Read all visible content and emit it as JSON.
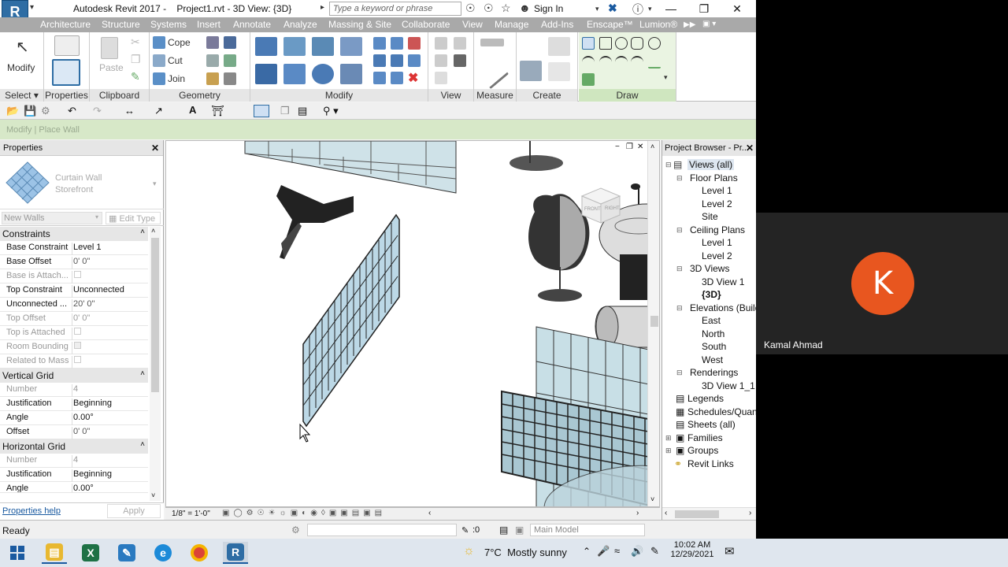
{
  "app": {
    "logo": "R",
    "title": "Autodesk Revit 2017 -",
    "file_title": "Project1.rvt - 3D View: {3D}",
    "search_placeholder": "Type a keyword or phrase",
    "sign_in": "Sign In",
    "window_controls": {
      "minimize": "—",
      "restore": "❐",
      "close": "✕"
    }
  },
  "tabs": [
    "Architecture",
    "Structure",
    "Systems",
    "Insert",
    "Annotate",
    "Analyze",
    "Massing & Site",
    "Collaborate",
    "View",
    "Manage",
    "Add-Ins",
    "Enscape™",
    "Lumion®"
  ],
  "ribbon": {
    "modify_label": "Modify",
    "paste_label": "Paste",
    "cope_label": "Cope",
    "cut_label": "Cut",
    "join_label": "Join",
    "panels": [
      "Select",
      "Properties",
      "Clipboard",
      "Geometry",
      "Modify",
      "View",
      "Measure",
      "Create",
      "Draw"
    ]
  },
  "option_bar": {
    "text": "Modify | Place Wall"
  },
  "properties": {
    "title": "Properties",
    "type_family": "Curtain Wall",
    "type_name": "Storefront",
    "instance_selector": "New Walls",
    "edit_type": "Edit Type",
    "groups": {
      "constraints": "Constraints",
      "vertical_grid": "Vertical Grid",
      "horizontal_grid": "Horizontal Grid"
    },
    "constraints": [
      {
        "k": "Base Constraint",
        "v": "Level 1"
      },
      {
        "k": "Base Offset",
        "v": "0'  0\""
      },
      {
        "k": "Base is Attach...",
        "v": ""
      },
      {
        "k": "Top Constraint",
        "v": "Unconnected"
      },
      {
        "k": "Unconnected ...",
        "v": "20'  0\""
      },
      {
        "k": "Top Offset",
        "v": "0'  0\""
      },
      {
        "k": "Top is Attached",
        "v": ""
      },
      {
        "k": "Room Bounding",
        "v": ""
      },
      {
        "k": "Related to Mass",
        "v": ""
      }
    ],
    "vertical_grid": [
      {
        "k": "Number",
        "v": "4"
      },
      {
        "k": "Justification",
        "v": "Beginning"
      },
      {
        "k": "Angle",
        "v": "0.00°"
      },
      {
        "k": "Offset",
        "v": "0'  0\""
      }
    ],
    "horizontal_grid": [
      {
        "k": "Number",
        "v": "4"
      },
      {
        "k": "Justification",
        "v": "Beginning"
      },
      {
        "k": "Angle",
        "v": "0.00°"
      }
    ],
    "help_link": "Properties help",
    "apply": "Apply"
  },
  "view": {
    "scale": "1/8\" = 1'-0\"",
    "viewcube_front": "FRONT",
    "viewcube_right": "RIGHT"
  },
  "project_browser": {
    "title": "Project Browser - Pr...",
    "items": [
      {
        "label": "Views (all)"
      },
      {
        "label": "Floor Plans"
      },
      {
        "label": "Level 1"
      },
      {
        "label": "Level 2"
      },
      {
        "label": "Site"
      },
      {
        "label": "Ceiling Plans"
      },
      {
        "label": "Level 1"
      },
      {
        "label": "Level 2"
      },
      {
        "label": "3D Views"
      },
      {
        "label": "3D View 1"
      },
      {
        "label": "{3D}"
      },
      {
        "label": "Elevations (Build"
      },
      {
        "label": "East"
      },
      {
        "label": "North"
      },
      {
        "label": "South"
      },
      {
        "label": "West"
      },
      {
        "label": "Renderings"
      },
      {
        "label": "3D View 1_1"
      },
      {
        "label": "Legends"
      },
      {
        "label": "Schedules/Quant"
      },
      {
        "label": "Sheets (all)"
      },
      {
        "label": "Families"
      },
      {
        "label": "Groups"
      },
      {
        "label": "Revit Links"
      }
    ]
  },
  "status": {
    "ready": "Ready",
    "zero": ":0",
    "model": "Main Model"
  },
  "participant": {
    "initial": "K",
    "name": "Kamal Ahmad",
    "avatar_color": "#e8561f"
  },
  "taskbar": {
    "weather_temp": "7°C",
    "weather_desc": "Mostly sunny",
    "time": "10:02 AM",
    "date": "12/29/2021"
  }
}
